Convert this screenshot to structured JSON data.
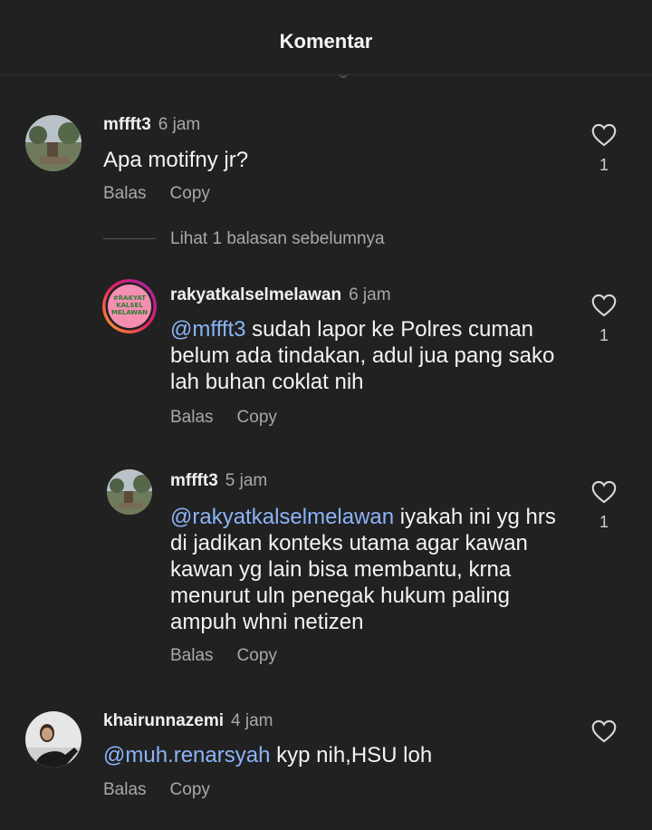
{
  "header": {
    "title": "Komentar"
  },
  "comments": [
    {
      "username": "mffft3",
      "time": "6 jam",
      "mention": "",
      "text": "Apa motifny jr?",
      "reply_label": "Balas",
      "copy_label": "Copy",
      "likes": "1"
    },
    {
      "username": "rakyatkalselmelawan",
      "time": "6 jam",
      "mention": "@mffft3",
      "text": " sudah lapor ke Polres cuman belum ada tindakan, adul jua pang sako lah buhan coklat nih",
      "reply_label": "Balas",
      "copy_label": "Copy",
      "likes": "1",
      "avatar_text": [
        "#RAKYAT",
        "KALSEL",
        "MELAWAN"
      ]
    },
    {
      "username": "mffft3",
      "time": "5 jam",
      "mention": "@rakyatkalselmelawan",
      "text": " iyakah ini yg hrs di jadikan konteks utama agar kawan kawan yg lain bisa membantu, krna menurut uln penegak hukum paling ampuh whni netizen",
      "reply_label": "Balas",
      "copy_label": "Copy",
      "likes": "1"
    },
    {
      "username": "khairunnazemi",
      "time": "4 jam",
      "mention": "@muh.renarsyah",
      "text": " kyp nih,HSU loh",
      "reply_label": "Balas",
      "copy_label": "Copy",
      "likes": ""
    }
  ],
  "view_replies": "Lihat 1 balasan sebelumnya",
  "colors": {
    "background": "#212121",
    "mention": "#8ab4f8",
    "secondary_text": "#a8a8a8"
  },
  "icons": {
    "like": "heart-outline-icon"
  }
}
